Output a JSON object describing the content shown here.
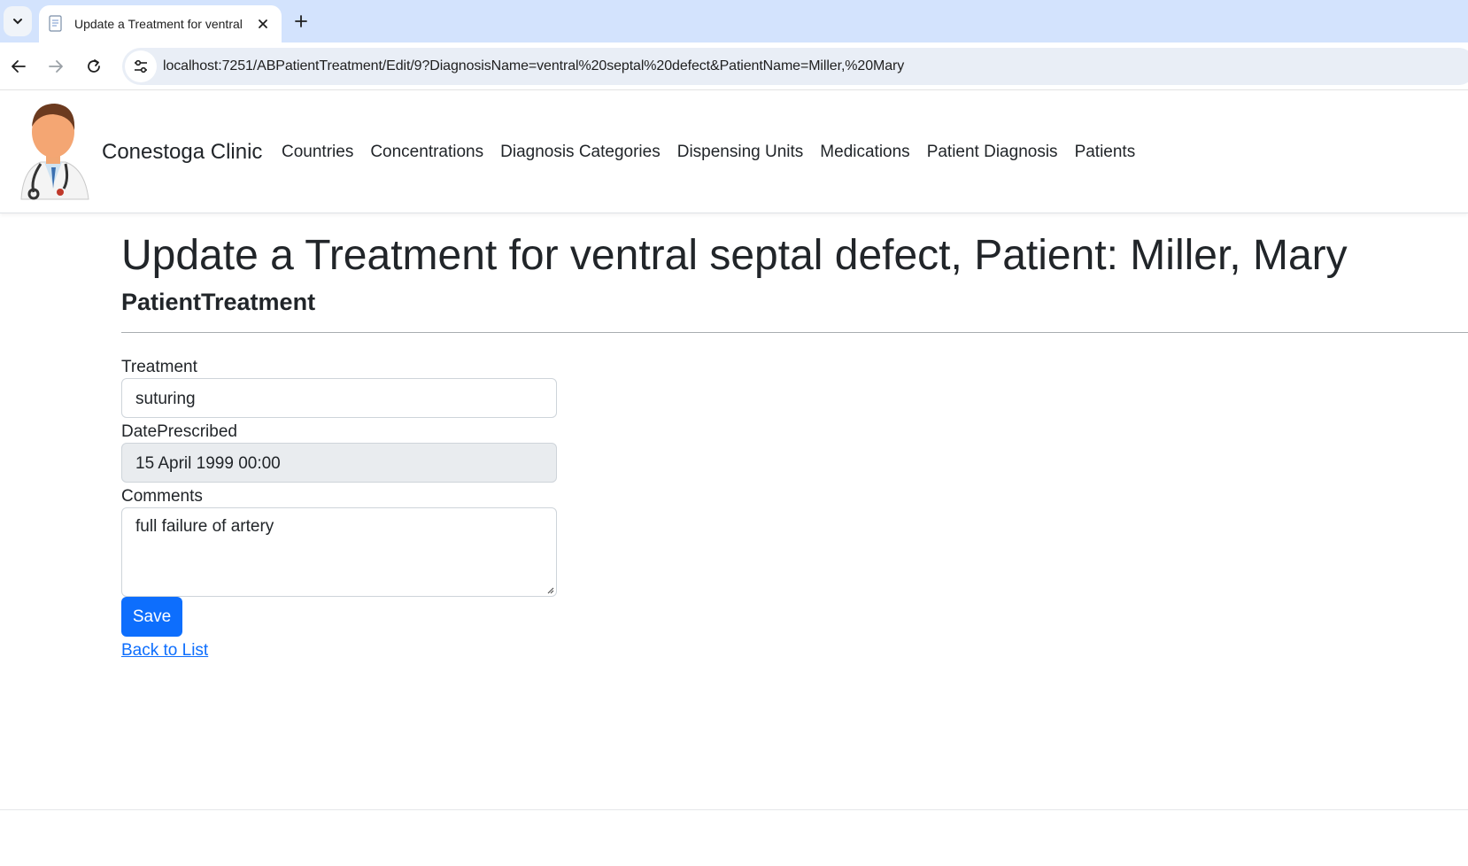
{
  "browser": {
    "tab_title": "Update a Treatment for ventral",
    "url": "localhost:7251/ABPatientTreatment/Edit/9?DiagnosisName=ventral%20septal%20defect&PatientName=Miller,%20Mary"
  },
  "navbar": {
    "brand": "Conestoga Clinic",
    "links": [
      "Countries",
      "Concentrations",
      "Diagnosis Categories",
      "Dispensing Units",
      "Medications",
      "Patient Diagnosis",
      "Patients"
    ]
  },
  "page": {
    "title": "Update a Treatment for ventral septal defect, Patient: Miller, Mary",
    "subtitle": "PatientTreatment"
  },
  "form": {
    "treatment_label": "Treatment",
    "treatment_value": "suturing",
    "date_label": "DatePrescribed",
    "date_value": "15 April 1999 00:00",
    "comments_label": "Comments",
    "comments_value": "full failure of artery",
    "save_label": "Save",
    "back_label": "Back to List"
  },
  "colors": {
    "primary": "#0d6efd",
    "tabstrip": "#d3e3fd",
    "readonly_bg": "#e9ecef"
  }
}
